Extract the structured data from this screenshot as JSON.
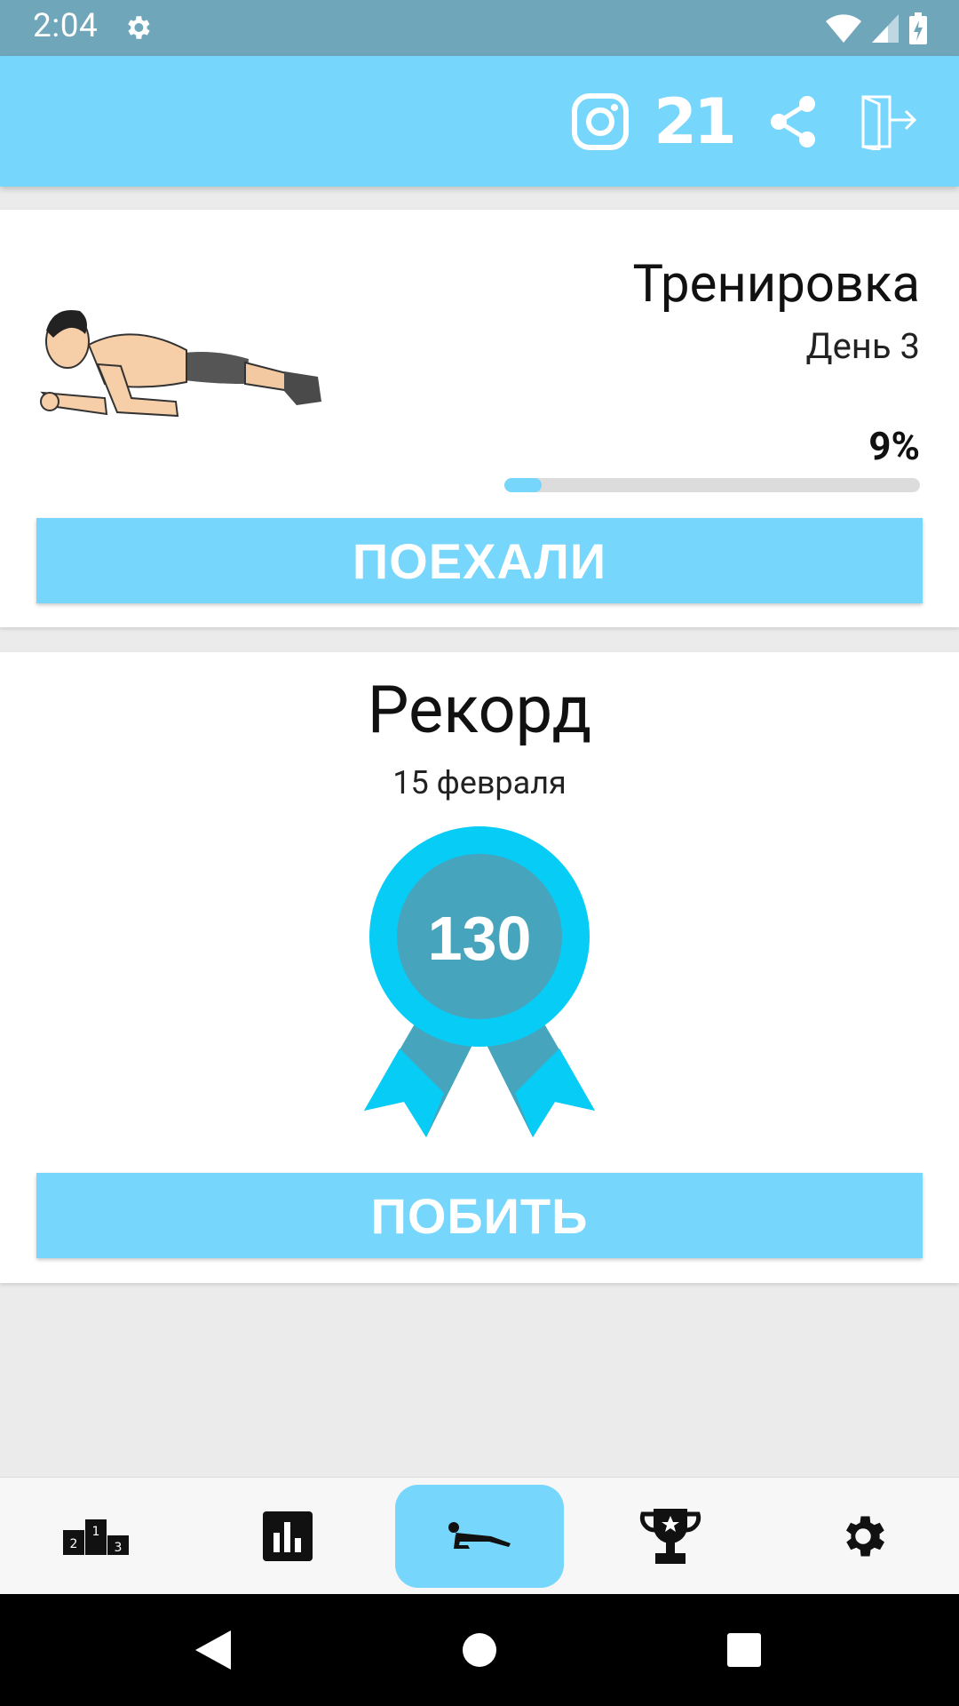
{
  "status_bar": {
    "time": "2:04",
    "icons": [
      "settings-icon",
      "wifi-icon",
      "signal-icon",
      "battery-icon"
    ]
  },
  "app_bar": {
    "icons": [
      "instagram-icon",
      "21-days-icon",
      "share-icon",
      "exit-icon"
    ],
    "days_label": "21",
    "color": "#76d6fb"
  },
  "workout_card": {
    "title": "Тренировка",
    "day": "День 3",
    "progress_label": "9%",
    "progress_value": 0.09,
    "button_label": "ПОЕХАЛИ",
    "image": "plank-man-illustration"
  },
  "record_card": {
    "title": "Рекорд",
    "date": "15 февраля",
    "record_value": "130",
    "button_label": "ПОБИТЬ",
    "badge_colors": {
      "outer": "#06ccf6",
      "inner": "#46a5bd"
    }
  },
  "bottom_nav": {
    "items": [
      {
        "icon": "podium-icon",
        "active": false
      },
      {
        "icon": "bar-chart-icon",
        "active": false
      },
      {
        "icon": "plank-icon",
        "active": true
      },
      {
        "icon": "trophy-icon",
        "active": false
      },
      {
        "icon": "settings-icon",
        "active": false
      }
    ]
  },
  "system_nav": {
    "icons": [
      "back-icon",
      "home-icon",
      "recents-icon"
    ]
  }
}
